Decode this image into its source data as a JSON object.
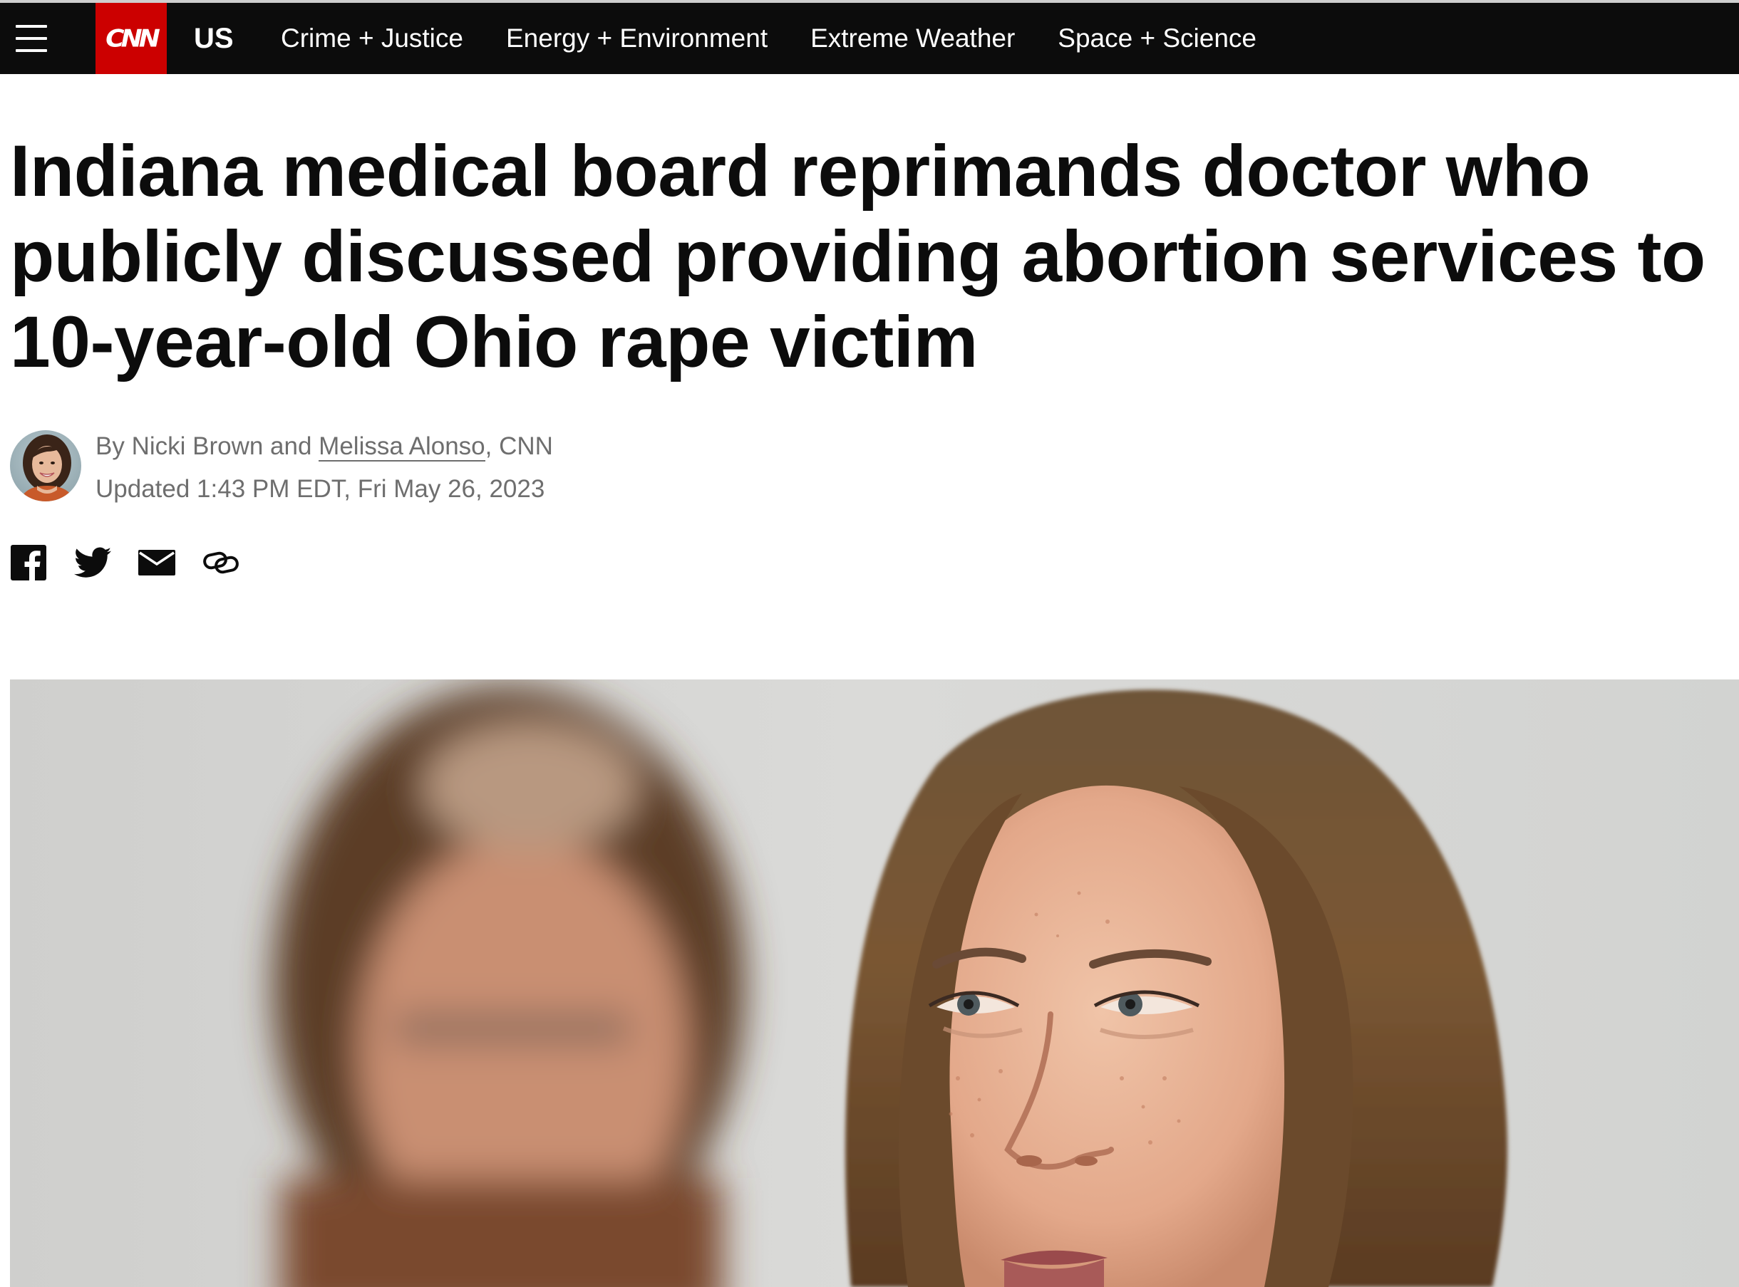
{
  "nav": {
    "logo": "CNN",
    "section": "US",
    "links": [
      "Crime + Justice",
      "Energy + Environment",
      "Extreme Weather",
      "Space + Science"
    ]
  },
  "article": {
    "headline": "Indiana medical board reprimands doctor who publicly discussed providing abortion services to 10-year-old Ohio rape victim",
    "byline_prefix": "By Nicki Brown and ",
    "author_link": "Melissa Alonso",
    "byline_suffix": ", CNN",
    "timestamp": "Updated 1:43 PM EDT, Fri May 26, 2023"
  },
  "share": {
    "icons": [
      "facebook-icon",
      "twitter-icon",
      "email-icon",
      "link-icon"
    ]
  },
  "colors": {
    "nav_background": "#0c0c0c",
    "brand_red": "#cc0000",
    "headline_text": "#0c0c0c",
    "meta_text": "#6e6e6e"
  }
}
